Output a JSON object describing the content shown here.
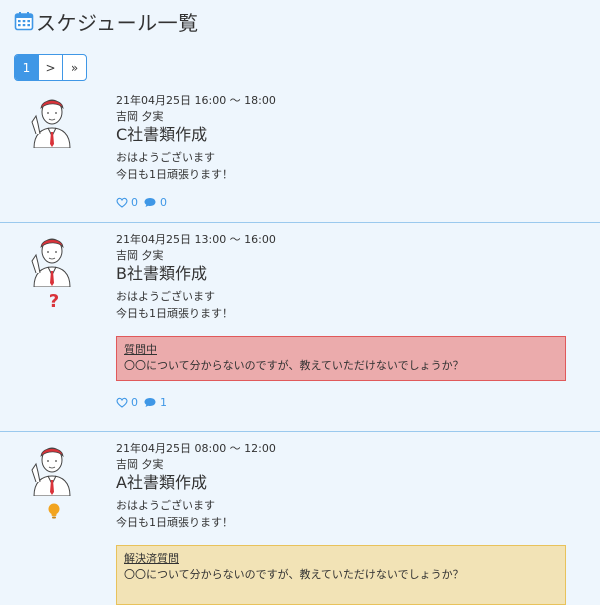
{
  "page": {
    "title": "スケジュール一覧",
    "title_icon": "calendar-icon"
  },
  "pagination": {
    "current": "1",
    "next": ">",
    "last": "»"
  },
  "colors": {
    "accent": "#3f97e6",
    "asking_bg": "#ebabac",
    "asking_border": "#e0595b",
    "resolved_bg": "#f2e3b6",
    "resolved_border": "#e8c25b",
    "question_icon": "#d9333a",
    "resolved_icon": "#f2a41f"
  },
  "schedules": [
    {
      "time": "21年04月25日 16:00 〜 18:00",
      "author": "吉岡 夕実",
      "title": "C社書類作成",
      "desc1": "おはようございます",
      "desc2": "今日も1日頑張ります！",
      "likes": "0",
      "comments": "0"
    },
    {
      "time": "21年04月25日 13:00 〜 16:00",
      "author": "吉岡 夕実",
      "title": "B社書類作成",
      "desc1": "おはようございます",
      "desc2": "今日も1日頑張ります！",
      "status_icon": "question-icon",
      "question_label": "質問中",
      "question_text": "〇〇について分からないのですが、教えていただけないでしょうか？",
      "likes": "0",
      "comments": "1"
    },
    {
      "time": "21年04月25日 08:00 〜 12:00",
      "author": "吉岡 夕実",
      "title": "A社書類作成",
      "desc1": "おはようございます",
      "desc2": "今日も1日頑張ります！",
      "status_icon": "lightbulb-icon",
      "question_label": "解決済質問",
      "question_text": "〇〇について分からないのですが、教えていただけないでしょうか？"
    }
  ]
}
